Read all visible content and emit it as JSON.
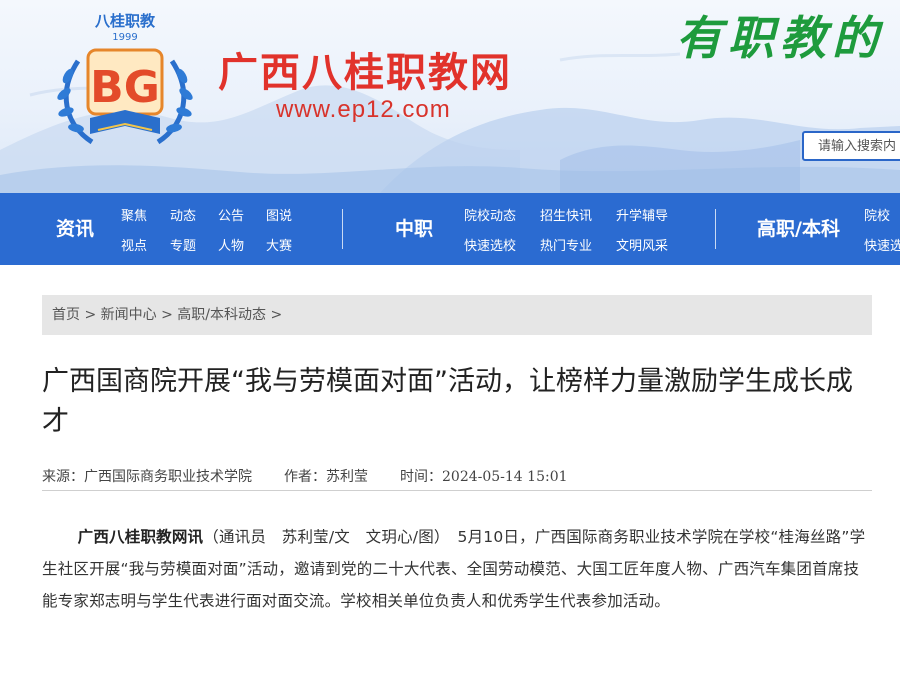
{
  "header": {
    "logo_text_top": "八桂职教",
    "logo_year": "1999",
    "logo_letters": "BG",
    "site_name": "广西八桂职教网",
    "site_url": "www.ep12.com",
    "slogan": "有职教的",
    "search_placeholder": "请输入搜索内"
  },
  "nav": {
    "groups": [
      {
        "label": "资讯",
        "links": [
          "聚焦",
          "动态",
          "公告",
          "图说",
          "视点",
          "专题",
          "人物",
          "大赛"
        ]
      },
      {
        "label": "中职",
        "links": [
          "院校动态",
          "招生快讯",
          "升学辅导",
          "快速选校",
          "热门专业",
          "文明风采"
        ]
      },
      {
        "label": "高职/本科",
        "links": [
          "院校",
          "快速选"
        ]
      }
    ]
  },
  "breadcrumb": {
    "items": [
      "首页",
      "新闻中心",
      "高职/本科动态"
    ],
    "separator": ">"
  },
  "article": {
    "title": "广西国商院开展“我与劳模面对面”活动，让榜样力量激励学生成长成才",
    "source_label": "来源：",
    "source": "广西国际商务职业技术学院",
    "author_label": "作者：",
    "author": "苏利莹",
    "time_label": "时间：",
    "time": "2024-05-14 15:01",
    "lead_bold": "广西八桂职教网讯",
    "body": "（通讯员　苏利莹/文　文玥心/图）　5月10日，广西国际商务职业技术学院在学校“桂海丝路”学生社区开展“我与劳模面对面”活动，邀请到党的二十大代表、全国劳动模范、大国工匠年度人物、广西汽车集团首席技能专家郑志明与学生代表进行面对面交流。学校相关单位负责人和优秀学生代表参加活动。"
  },
  "colors": {
    "nav": "#2b6bd1",
    "brand_red": "#e1322b",
    "slogan_green": "#1e9b3d"
  }
}
